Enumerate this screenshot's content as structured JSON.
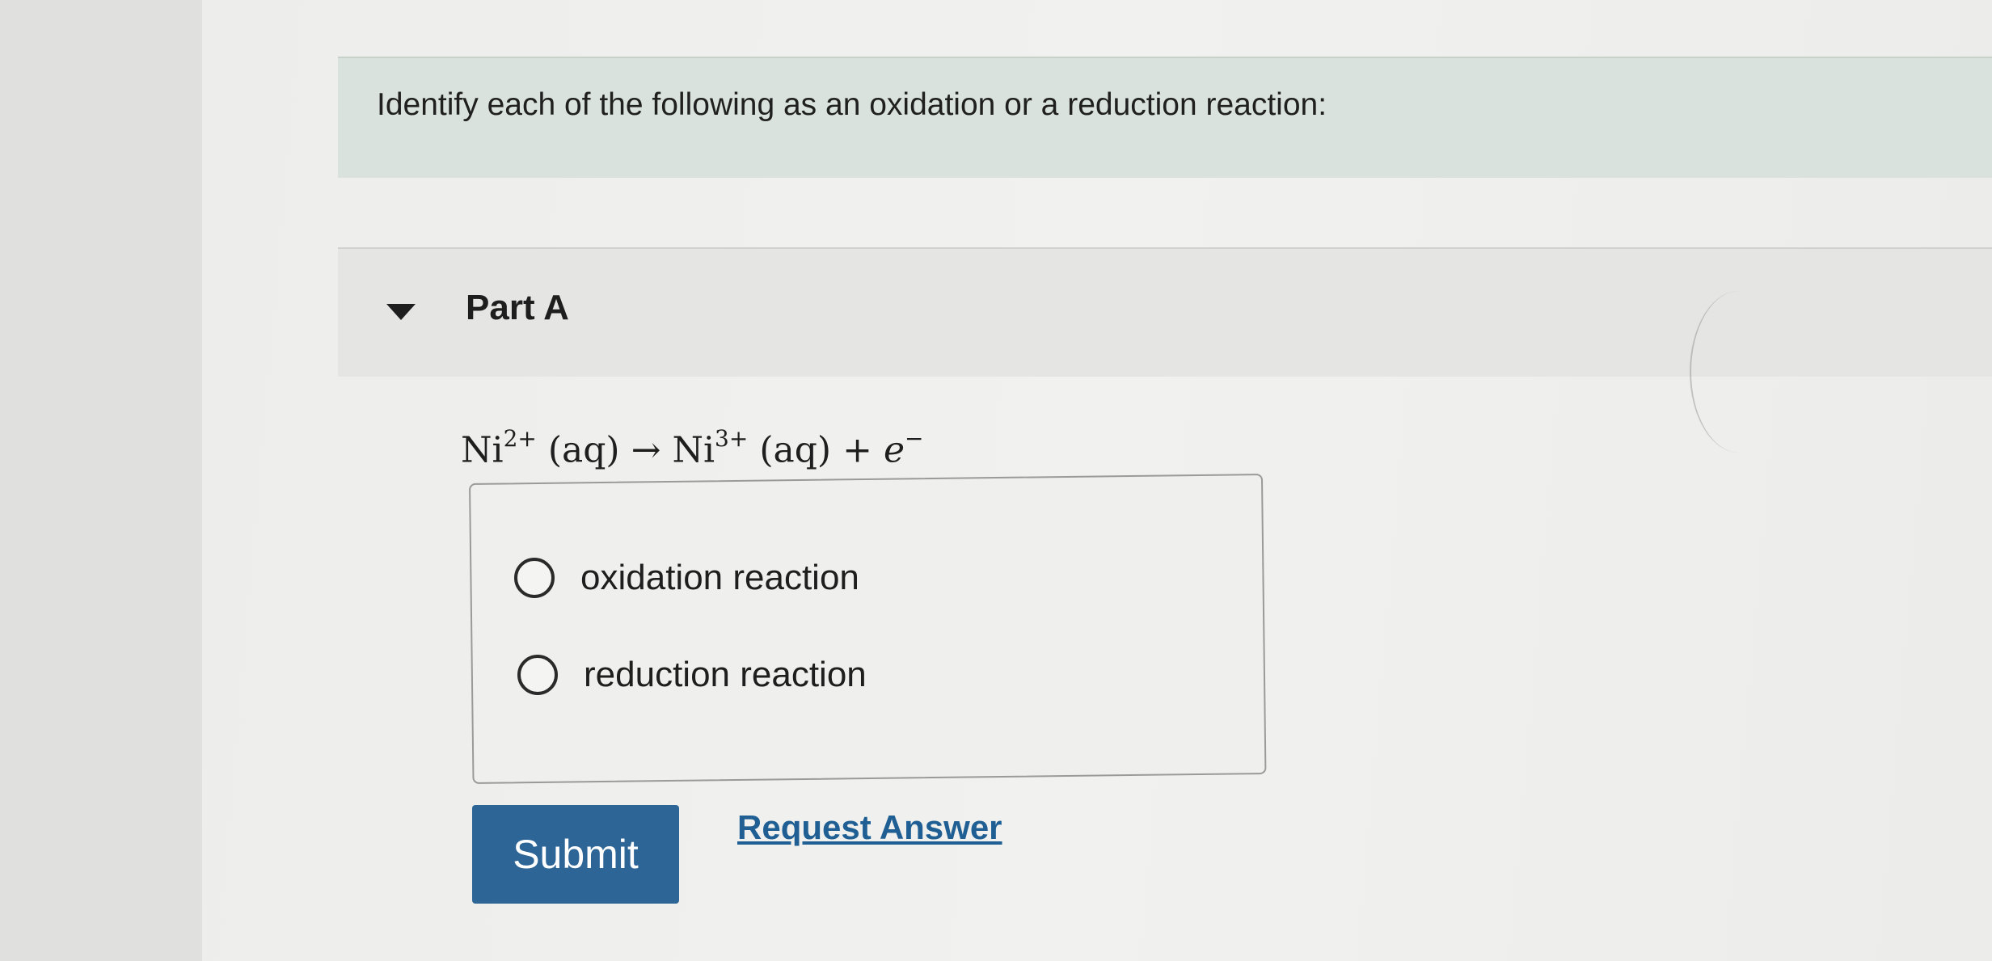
{
  "problem": {
    "instruction": "Identify each of the following as an oxidation or a reduction reaction:"
  },
  "part": {
    "title": "Part A",
    "equation": {
      "reactant_symbol": "Ni",
      "reactant_charge": "2+",
      "reactant_state": "(aq)",
      "arrow": "→",
      "product_symbol": "Ni",
      "product_charge": "3+",
      "product_state": "(aq)",
      "plus": "+",
      "electron": "e",
      "electron_charge": "−"
    },
    "choices": [
      {
        "label": "oxidation reaction",
        "selected": false
      },
      {
        "label": "reduction reaction",
        "selected": false
      }
    ]
  },
  "actions": {
    "submit_label": "Submit",
    "request_answer_label": "Request Answer"
  },
  "colors": {
    "submit_bg": "#2d6597",
    "link": "#1f5f93",
    "banner_bg": "#d9e2dc"
  }
}
